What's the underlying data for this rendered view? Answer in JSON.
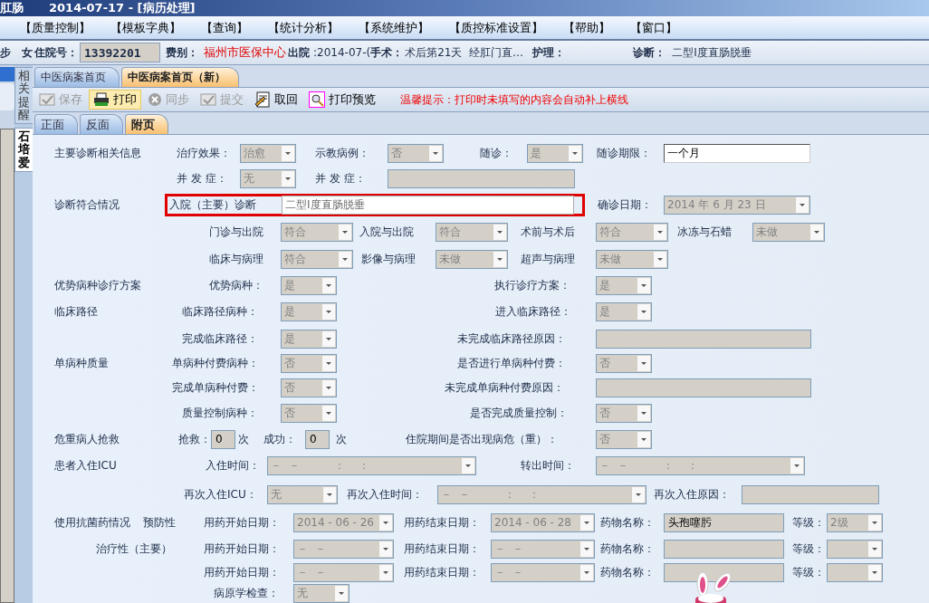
{
  "window": {
    "title": "肛肠",
    "subtitle": "2014-07-17 - [病历处理]"
  },
  "menu": [
    "【质量控制】",
    "【模板字典】",
    "【查询】",
    "【统计分析】",
    "【系统维护】",
    "【质控标准设置】",
    "【帮助】",
    "【窗口】"
  ],
  "patient_bar": [
    {
      "kind": "label",
      "text": "步"
    },
    {
      "kind": "label",
      "text": "女"
    },
    {
      "kind": "label",
      "text": "住院号："
    },
    {
      "kind": "field",
      "text": "13392201"
    },
    {
      "kind": "label",
      "text": "费别："
    },
    {
      "kind": "alert",
      "text": "福州市医保中心"
    },
    {
      "kind": "label",
      "text": "出院"
    },
    {
      "kind": "text",
      "text": ":2014-07-("
    },
    {
      "kind": "label",
      "text": "手术："
    },
    {
      "kind": "text",
      "text": "术后第21天  经肛门直…"
    },
    {
      "kind": "label",
      "text": "护理："
    },
    {
      "kind": "label",
      "text": "诊断："
    },
    {
      "kind": "text",
      "text": "二型Ⅰ度直肠脱垂"
    }
  ],
  "vertical_tabs": [
    {
      "label": "相关提醒",
      "selected": false
    },
    {
      "label": "石培爱",
      "selected": true
    }
  ],
  "tabs": [
    {
      "label": "中医病案首页",
      "selected": false
    },
    {
      "label": "中医病案首页（新）",
      "selected": true
    }
  ],
  "toolbar": {
    "buttons": [
      {
        "label": "保存",
        "disabled": true,
        "highlighted": false
      },
      {
        "label": "打印",
        "disabled": false,
        "highlighted": true
      },
      {
        "label": "同步",
        "disabled": true,
        "highlighted": false
      },
      {
        "label": "提交",
        "disabled": true,
        "highlighted": false
      },
      {
        "label": "取回",
        "disabled": false,
        "highlighted": false
      },
      {
        "label": "打印预览",
        "disabled": false,
        "highlighted": false
      }
    ],
    "notice": "温馨提示：打印时未填写的内容会自动补上横线"
  },
  "subtabs": [
    {
      "label": "正面",
      "selected": false
    },
    {
      "label": "反面",
      "selected": false
    },
    {
      "label": "附页",
      "selected": true
    }
  ],
  "form": {
    "rows": [
      {
        "items": [
          {
            "kind": "section",
            "text": "主要诊断相关信息"
          },
          {
            "kind": "label",
            "text": "治疗效果："
          },
          {
            "kind": "select",
            "value": "治愈"
          },
          {
            "kind": "label",
            "text": "示教病例："
          },
          {
            "kind": "select",
            "value": "否"
          },
          {
            "kind": "label",
            "text": "随诊："
          },
          {
            "kind": "select",
            "value": "是"
          },
          {
            "kind": "label",
            "text": "随诊期限："
          },
          {
            "kind": "input",
            "value": "一个月",
            "disabled": false
          }
        ]
      },
      {
        "items": [
          {
            "kind": "label",
            "text": "并 发 症："
          },
          {
            "kind": "select",
            "value": "无"
          },
          {
            "kind": "label",
            "text": "并 发 症："
          },
          {
            "kind": "field"
          }
        ]
      },
      {
        "items": [
          {
            "kind": "section",
            "text": "诊断符合情况"
          },
          {
            "kind": "group",
            "highlighted": true,
            "items": [
              {
                "kind": "label",
                "text": "入院（主要）诊断"
              },
              {
                "kind": "input",
                "value": "二型Ⅰ度直肠脱垂",
                "disabled": true
              }
            ]
          },
          {
            "kind": "label",
            "text": "确诊日期："
          },
          {
            "kind": "select",
            "value": "2014 年 6 月 23 日"
          }
        ]
      },
      {
        "items": [
          {
            "kind": "label",
            "text": "门诊与出院"
          },
          {
            "kind": "select",
            "value": "符合"
          },
          {
            "kind": "label",
            "text": "入院与出院"
          },
          {
            "kind": "select",
            "value": "符合"
          },
          {
            "kind": "label",
            "text": "术前与术后"
          },
          {
            "kind": "select",
            "value": "符合"
          },
          {
            "kind": "label",
            "text": "冰冻与石蜡"
          },
          {
            "kind": "select",
            "value": "未做"
          }
        ]
      },
      {
        "items": [
          {
            "kind": "label",
            "text": "临床与病理"
          },
          {
            "kind": "select",
            "value": "符合"
          },
          {
            "kind": "label",
            "text": "影像与病理"
          },
          {
            "kind": "select",
            "value": "未做"
          },
          {
            "kind": "label",
            "text": "超声与病理"
          },
          {
            "kind": "select",
            "value": "未做"
          }
        ]
      },
      {
        "items": [
          {
            "kind": "section",
            "text": "优势病种诊疗方案"
          },
          {
            "kind": "label",
            "text": "优势病种："
          },
          {
            "kind": "select",
            "value": "是"
          },
          {
            "kind": "label",
            "text": "执行诊疗方案："
          },
          {
            "kind": "select",
            "value": "是"
          }
        ]
      },
      {
        "items": [
          {
            "kind": "section",
            "text": "临床路径"
          },
          {
            "kind": "label",
            "text": "临床路径病种："
          },
          {
            "kind": "select",
            "value": "是"
          },
          {
            "kind": "label",
            "text": "进入临床路径："
          },
          {
            "kind": "select",
            "value": "是"
          }
        ]
      },
      {
        "items": [
          {
            "kind": "label",
            "text": "完成临床路径："
          },
          {
            "kind": "select",
            "value": "是"
          },
          {
            "kind": "label",
            "text": "未完成临床路径原因："
          },
          {
            "kind": "field"
          }
        ]
      },
      {
        "items": [
          {
            "kind": "section",
            "text": "单病种质量"
          },
          {
            "kind": "label",
            "text": "单病种付费病种："
          },
          {
            "kind": "select",
            "value": "否"
          },
          {
            "kind": "label",
            "text": "是否进行单病种付费："
          },
          {
            "kind": "select",
            "value": "否"
          }
        ]
      },
      {
        "items": [
          {
            "kind": "label",
            "text": "完成单病种付费："
          },
          {
            "kind": "select",
            "value": "否"
          },
          {
            "kind": "label",
            "text": "未完成单病种付费原因："
          },
          {
            "kind": "field"
          }
        ]
      },
      {
        "items": [
          {
            "kind": "label",
            "text": "质量控制病种："
          },
          {
            "kind": "select",
            "value": "否"
          },
          {
            "kind": "label",
            "text": "是否完成质量控制："
          },
          {
            "kind": "select",
            "value": "否"
          }
        ]
      },
      {
        "items": [
          {
            "kind": "section",
            "text": "危重病人抢救"
          },
          {
            "kind": "label",
            "text": "抢救："
          },
          {
            "kind": "field",
            "value": "0"
          },
          {
            "kind": "label",
            "text": "次"
          },
          {
            "kind": "label",
            "text": "成功："
          },
          {
            "kind": "field",
            "value": "0"
          },
          {
            "kind": "label",
            "text": "次"
          },
          {
            "kind": "label",
            "text": "住院期间是否出现病危（重）："
          },
          {
            "kind": "select",
            "value": "否"
          }
        ]
      },
      {
        "items": [
          {
            "kind": "section",
            "text": "患者入住ICU"
          },
          {
            "kind": "label",
            "text": "入住时间："
          },
          {
            "kind": "select",
            "value": "－  －          ：    ："
          },
          {
            "kind": "label",
            "text": "转出时间："
          },
          {
            "kind": "select",
            "value": "－  －          ：    ："
          }
        ]
      },
      {
        "items": [
          {
            "kind": "label",
            "text": "再次入住ICU："
          },
          {
            "kind": "select",
            "value": "无"
          },
          {
            "kind": "label",
            "text": "再次入住时间："
          },
          {
            "kind": "select",
            "value": "－  －          ：    ："
          },
          {
            "kind": "label",
            "text": "再次入住原因："
          },
          {
            "kind": "field"
          }
        ]
      },
      {
        "items": [
          {
            "kind": "section",
            "text": "使用抗菌药情况"
          },
          {
            "kind": "section",
            "text": "预防性"
          },
          {
            "kind": "label",
            "text": "用药开始日期："
          },
          {
            "kind": "select",
            "value": "2014 - 06 - 26"
          },
          {
            "kind": "label",
            "text": "用药结束日期："
          },
          {
            "kind": "select",
            "value": "2014 - 06 - 28"
          },
          {
            "kind": "label",
            "text": "药物名称："
          },
          {
            "kind": "field",
            "value": "头孢噻肟"
          },
          {
            "kind": "label",
            "text": "等级："
          },
          {
            "kind": "select",
            "value": "2级"
          }
        ]
      },
      {
        "items": [
          {
            "kind": "section",
            "text": "治疗性（主要）"
          },
          {
            "kind": "label",
            "text": "用药开始日期："
          },
          {
            "kind": "select",
            "value": "－  －"
          },
          {
            "kind": "label",
            "text": "用药结束日期："
          },
          {
            "kind": "select",
            "value": "－  －"
          },
          {
            "kind": "label",
            "text": "药物名称："
          },
          {
            "kind": "field"
          },
          {
            "kind": "label",
            "text": "等级："
          },
          {
            "kind": "select"
          }
        ]
      },
      {
        "items": [
          {
            "kind": "label",
            "text": "用药开始日期："
          },
          {
            "kind": "select",
            "value": "－  －"
          },
          {
            "kind": "label",
            "text": "用药结束日期："
          },
          {
            "kind": "select",
            "value": "－  －"
          },
          {
            "kind": "label",
            "text": "药物名称："
          },
          {
            "kind": "field"
          },
          {
            "kind": "label",
            "text": "等级："
          },
          {
            "kind": "select"
          }
        ]
      },
      {
        "items": [
          {
            "kind": "label",
            "text": "病原学检查："
          },
          {
            "kind": "select",
            "value": "无"
          }
        ]
      }
    ]
  }
}
